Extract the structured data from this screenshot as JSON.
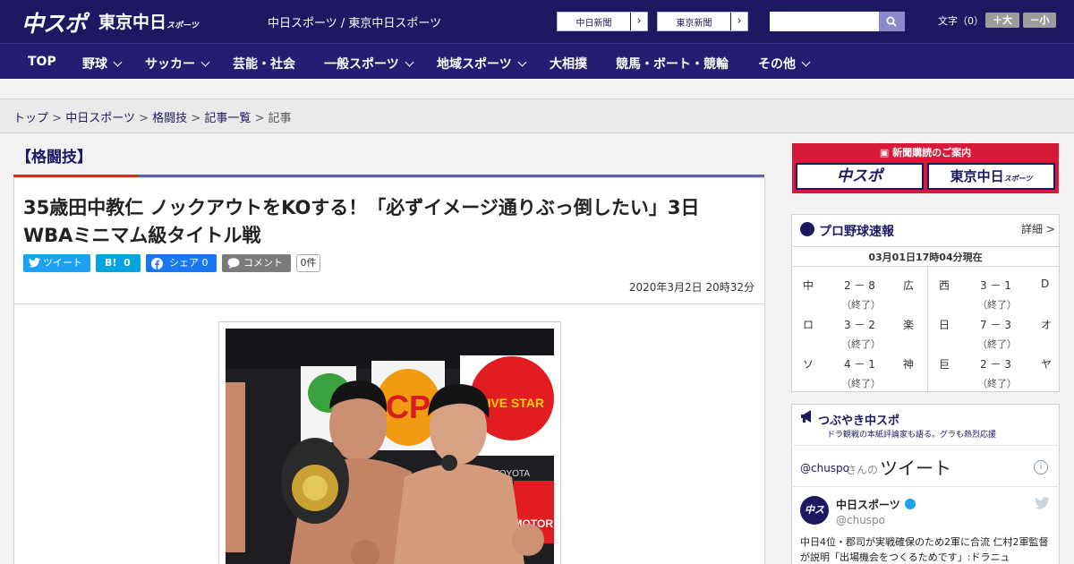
{
  "header": {
    "logo_chuspo": "中スポ",
    "logo_tokyo": "東京中日",
    "logo_tokyo_small": "スポーツ",
    "site_tagline": "中日スポーツ / 東京中日スポーツ",
    "paper_links": [
      {
        "label": "中日新聞"
      },
      {
        "label": "東京新聞"
      }
    ],
    "search_placeholder": "",
    "font_size_label": "文字（0）",
    "font_up": "＋大",
    "font_down": "－小"
  },
  "nav": {
    "items": [
      {
        "label": "TOP",
        "dropdown": false
      },
      {
        "label": "野球",
        "dropdown": true
      },
      {
        "label": "サッカー",
        "dropdown": true
      },
      {
        "label": "芸能・社会",
        "dropdown": false
      },
      {
        "label": "一般スポーツ",
        "dropdown": true
      },
      {
        "label": "地域スポーツ",
        "dropdown": true
      },
      {
        "label": "大相撲",
        "dropdown": false
      },
      {
        "label": "競馬・ボート・競輪",
        "dropdown": false
      },
      {
        "label": "その他",
        "dropdown": true
      }
    ]
  },
  "breadcrumb": {
    "items": [
      "トップ",
      "中日スポーツ",
      "格闘技",
      "記事一覧"
    ],
    "current": "記事",
    "separator": ">"
  },
  "article": {
    "category": "【格闘技】",
    "headline": "35歳田中教仁 ノックアウトをKOする！「必ずイメージ通りぶっ倒したい」3日WBAミニマム級タイトル戦",
    "share": {
      "tweet": "ツイート",
      "hatena_label": "B!",
      "hatena_count": "0",
      "facebook": "シェア 0",
      "comment": "コメント",
      "comment_count": "0件"
    },
    "date": "2020年3月2日 20時32分",
    "photo_signage": [
      "CP",
      "FIVE STAR",
      "TOYOTA",
      "MOTOR"
    ]
  },
  "sidebar": {
    "ad": {
      "caption": "新聞購読のご案内",
      "buttons": [
        {
          "label": "中スポ"
        },
        {
          "label": "東京中日",
          "small": "スポーツ"
        }
      ]
    },
    "baseball": {
      "title": "プロ野球速報",
      "more": "詳細 >",
      "timestamp": "03月01日17時04分現在",
      "games": [
        {
          "home": "中",
          "score": "2 － 8",
          "away": "広",
          "status": "（終了）"
        },
        {
          "home": "西",
          "score": "3 － 1",
          "away": "D",
          "status": "（終了）"
        },
        {
          "home": "ロ",
          "score": "3 － 2",
          "away": "楽",
          "status": "（終了）"
        },
        {
          "home": "日",
          "score": "7 － 3",
          "away": "オ",
          "status": "（終了）"
        },
        {
          "home": "ソ",
          "score": "4 － 1",
          "away": "神",
          "status": "（終了）"
        },
        {
          "home": "巨",
          "score": "2 － 3",
          "away": "ヤ",
          "status": "（終了）"
        }
      ]
    },
    "tweets": {
      "title": "つぶやき中スポ",
      "subtitle": "ドラ観戦の本紙評論家も語る。グラも熱烈応援",
      "handle": "@chuspo",
      "handle_suffix": "さんの",
      "tweet_word": "ツイート",
      "info": "i",
      "account_name": "中日スポーツ",
      "account_handle": "@chuspo",
      "avatar_text": "中スポ",
      "text": "中日4位・郡司が実戦確保のため2軍に合流 仁村2軍監督が説明「出場機会をつくるためです」:ドラニュ"
    }
  },
  "colors": {
    "header_bg": "#1e1863",
    "nav_bg": "#251d71",
    "accent_red": "#e1261c",
    "accent_purple": "#6360a8",
    "twitter_blue": "#1da1f2",
    "facebook_blue": "#1877f2",
    "hatena_blue": "#00a4de",
    "ad_red": "#d71a3a"
  }
}
